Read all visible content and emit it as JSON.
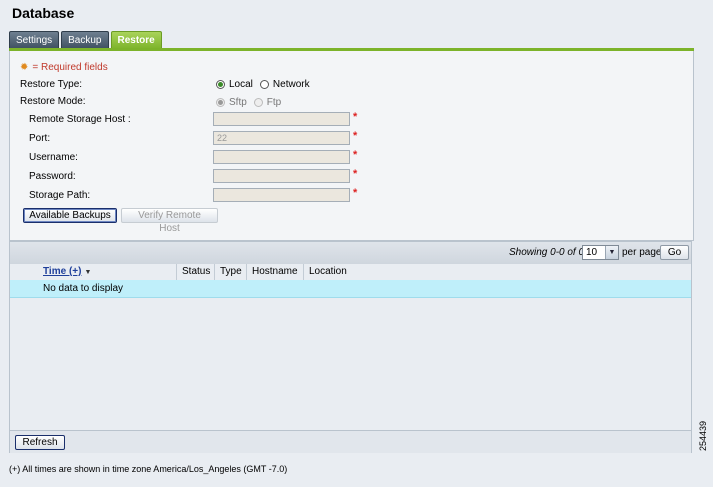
{
  "page": {
    "title": "Database"
  },
  "tabs": [
    {
      "label": "Settings",
      "active": false
    },
    {
      "label": "Backup",
      "active": false
    },
    {
      "label": "Restore",
      "active": true
    }
  ],
  "form": {
    "required_note": "= Required fields",
    "restore_type": {
      "label": "Restore Type:",
      "options": [
        "Local",
        "Network"
      ],
      "selected": "Local"
    },
    "restore_mode": {
      "label": "Restore Mode:",
      "options": [
        "Sftp",
        "Ftp"
      ],
      "selected": "Sftp",
      "disabled": true
    },
    "remote_host": {
      "label": "Remote Storage Host :",
      "value": ""
    },
    "port": {
      "label": "Port:",
      "value": "22"
    },
    "username": {
      "label": "Username:",
      "value": ""
    },
    "password": {
      "label": "Password:",
      "value": ""
    },
    "storage_path": {
      "label": "Storage Path:",
      "value": ""
    },
    "required_mark": "*",
    "available_backups_label": "Available Backups",
    "verify_remote_host_label": "Verify Remote Host"
  },
  "grid": {
    "pager_text": "Showing 0-0 of 0",
    "per_page_value": "10",
    "per_page_label": "per page",
    "go_label": "Go",
    "columns": [
      "Time (+)",
      "Status",
      "Type",
      "Hostname",
      "Location"
    ],
    "sort_indicator": "▼",
    "empty_message": "No data to display",
    "refresh_label": "Refresh"
  },
  "footnote": "(+) All times are shown in time zone America/Los_Angeles (GMT -7.0)",
  "figure_id": "254439"
}
